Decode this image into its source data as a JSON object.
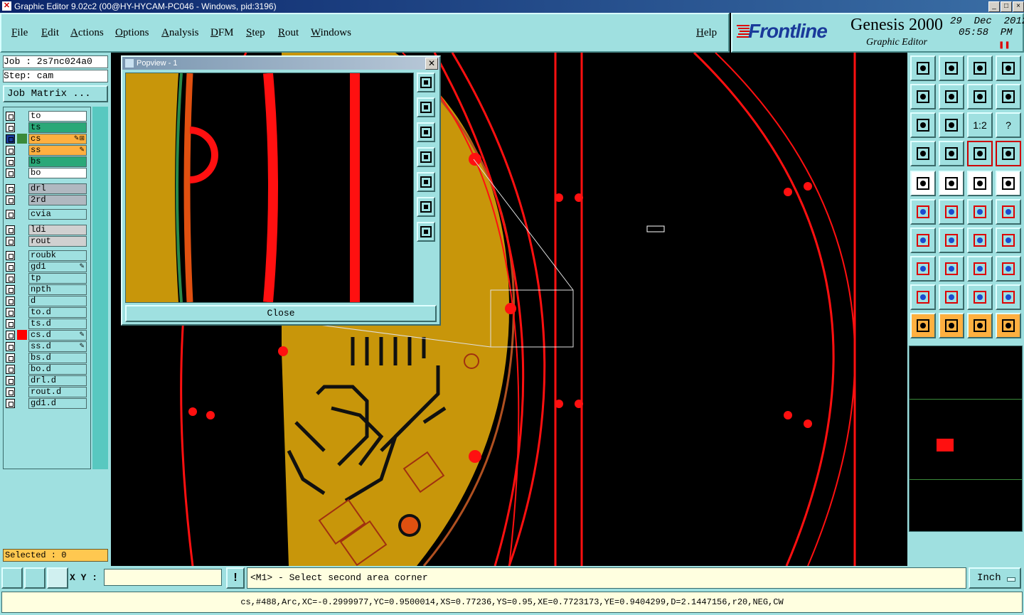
{
  "window": {
    "title": "Graphic Editor 9.02c2 (00@HY-HYCAM-PC046 - Windows, pid:3196)",
    "controls": [
      "_",
      "□",
      "×"
    ]
  },
  "menu": {
    "items": [
      "File",
      "Edit",
      "Actions",
      "Options",
      "Analysis",
      "DFM",
      "Step",
      "Rout",
      "Windows"
    ],
    "help": "Help"
  },
  "brand": {
    "logo_text": "Frontline",
    "product": "Genesis 2000",
    "subtitle": "Graphic Editor",
    "date": "29  Dec  2012",
    "time": "05:58  PM",
    "pause_glyph": "❚❚"
  },
  "job": {
    "job_label": "Job : 2s7nc024a0",
    "step_label": "Step: cam",
    "matrix_button": "Job Matrix ..."
  },
  "layers": {
    "group1": [
      {
        "name": "to",
        "bg": "#ffffff",
        "flag": ""
      },
      {
        "name": "ts",
        "bg": "#2aa878",
        "flag": ""
      },
      {
        "name": "cs",
        "bg": "#ffb040",
        "flag": "✎⊞",
        "color": "#3a8a3a",
        "selected": true
      },
      {
        "name": "ss",
        "bg": "#ffb040",
        "flag": "✎"
      },
      {
        "name": "bs",
        "bg": "#2aa878",
        "flag": ""
      },
      {
        "name": "bo",
        "bg": "#ffffff",
        "flag": ""
      }
    ],
    "group2": [
      {
        "name": "drl",
        "bg": "#b0b8c0"
      },
      {
        "name": "2rd",
        "bg": "#b0b8c0"
      }
    ],
    "group3": [
      {
        "name": "cvia",
        "bg": "#9fe0e0"
      }
    ],
    "group4": [
      {
        "name": "ldi",
        "bg": "#d0d0d0"
      },
      {
        "name": "rout",
        "bg": "#d0d0d0"
      }
    ],
    "group5": [
      {
        "name": "roubk",
        "flag": ""
      },
      {
        "name": "gd1",
        "flag": "✎"
      },
      {
        "name": "tp",
        "flag": ""
      },
      {
        "name": "npth",
        "flag": ""
      },
      {
        "name": "d",
        "flag": ""
      },
      {
        "name": "to.d",
        "flag": ""
      },
      {
        "name": "ts.d",
        "flag": ""
      },
      {
        "name": "cs.d",
        "flag": "✎",
        "color": "#ff0000"
      },
      {
        "name": "ss.d",
        "flag": "✎"
      },
      {
        "name": "bs.d",
        "flag": ""
      },
      {
        "name": "bo.d",
        "flag": ""
      },
      {
        "name": "drl.d",
        "flag": ""
      },
      {
        "name": "rout.d",
        "flag": ""
      },
      {
        "name": "gd1.d",
        "flag": ""
      }
    ]
  },
  "selected": "Selected : 0",
  "popview": {
    "title": "Popview - 1",
    "close_label": "Close"
  },
  "bottom": {
    "xy_label": "X Y :",
    "xy_value": "",
    "warn_glyph": "!",
    "prompt": "<M1> - Select second area corner",
    "units": "Inch",
    "status": "cs,#488,Arc,XC=-0.2999977,YC=0.9500014,XS=0.77236,YS=0.95,XE=0.7723173,YE=0.9404299,D=2.1447156,r20,NEG,CW"
  },
  "toolbox": {
    "icons": [
      "zoom-home-icon",
      "zoom-prev-icon",
      "home-icon",
      "window-icon",
      "pan-left-icon",
      "pan-right-icon",
      "pan-center-icon",
      "redraw-icon",
      "zoom-fit-icon",
      "zoom-center-icon",
      "scale-one-to-one-icon",
      "help-icon",
      "ruler-settings-icon",
      "grid-icon",
      "snap-icon",
      "snap-alt-icon",
      "select-feature-icon",
      "measure-icon",
      "ruler-icon",
      "pad-icon",
      "connect-icon",
      "delete-icon",
      "move-icon",
      "copy-icon",
      "line-icon",
      "segment-icon",
      "arc-icon",
      "text-icon",
      "surface-icon",
      "split-icon",
      "resize-icon",
      "shapes-icon",
      "outline-icon",
      "triangle-a-icon",
      "triangle-b-icon",
      "triangle-c-icon",
      "pointer-icon",
      "pointer-select-icon",
      "pointer-filter-icon",
      "route-icon"
    ],
    "labels": {
      "scale": "1:2",
      "help": "?"
    }
  }
}
